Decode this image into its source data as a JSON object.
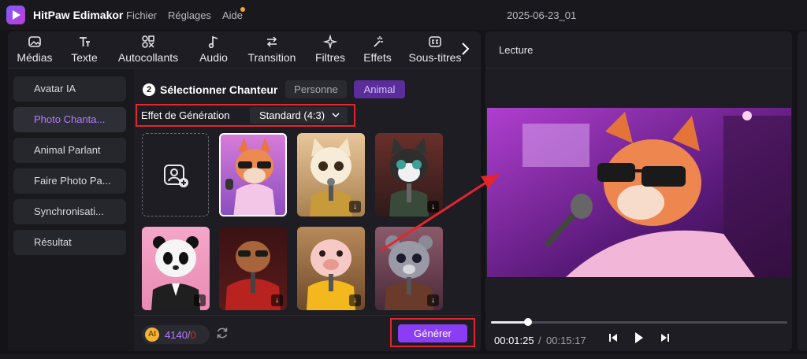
{
  "app": {
    "name": "HitPaw Edimakor",
    "project_title": "2025-06-23_01"
  },
  "menu": [
    {
      "label": "Fichier"
    },
    {
      "label": "Réglages"
    },
    {
      "label": "Aide"
    }
  ],
  "toolbar": {
    "tools": [
      {
        "label": "Médias",
        "icon": "media-icon"
      },
      {
        "label": "Texte",
        "icon": "text-icon"
      },
      {
        "label": "Autocollants",
        "icon": "sticker-icon"
      },
      {
        "label": "Audio",
        "icon": "music-note-icon"
      },
      {
        "label": "Transition",
        "icon": "transition-arrows-icon"
      },
      {
        "label": "Filtres",
        "icon": "sparkle-icon"
      },
      {
        "label": "Effets",
        "icon": "effects-wand-icon"
      },
      {
        "label": "Sous-titres",
        "icon": "captions-icon"
      }
    ]
  },
  "sidebar": {
    "items": [
      {
        "label": "Avatar IA"
      },
      {
        "label": "Photo Chanta..."
      },
      {
        "label": "Animal Parlant"
      },
      {
        "label": "Faire Photo Pa..."
      },
      {
        "label": "Synchronisati..."
      },
      {
        "label": "Résultat"
      }
    ],
    "active_index": 1
  },
  "singer": {
    "step": "2",
    "title": "Sélectionner Chanteur",
    "tabs": [
      {
        "label": "Personne"
      },
      {
        "label": "Animal"
      }
    ],
    "active_tab": "Animal"
  },
  "effect": {
    "label": "Effet de Génération",
    "value": "Standard (4:3)"
  },
  "thumbnails": [
    {
      "subject": "fox with sunglasses",
      "selected": true
    },
    {
      "subject": "kitten with microphone"
    },
    {
      "subject": "cat singer"
    },
    {
      "subject": "panda in suit"
    },
    {
      "subject": "dog in red fur coat"
    },
    {
      "subject": "pig in yellow jacket"
    },
    {
      "subject": "gray bear cub"
    }
  ],
  "credits": {
    "value": "4140",
    "separator": "/",
    "max": "0"
  },
  "generate_button": "Générer",
  "player": {
    "label": "Lecture",
    "current_time": "00:01:25",
    "separator": "/",
    "total_time": "00:15:17",
    "progress": 0.125
  },
  "colors": {
    "accent": "#8b3df5",
    "highlight_red": "#e0262e",
    "active_text": "#b27dff"
  }
}
